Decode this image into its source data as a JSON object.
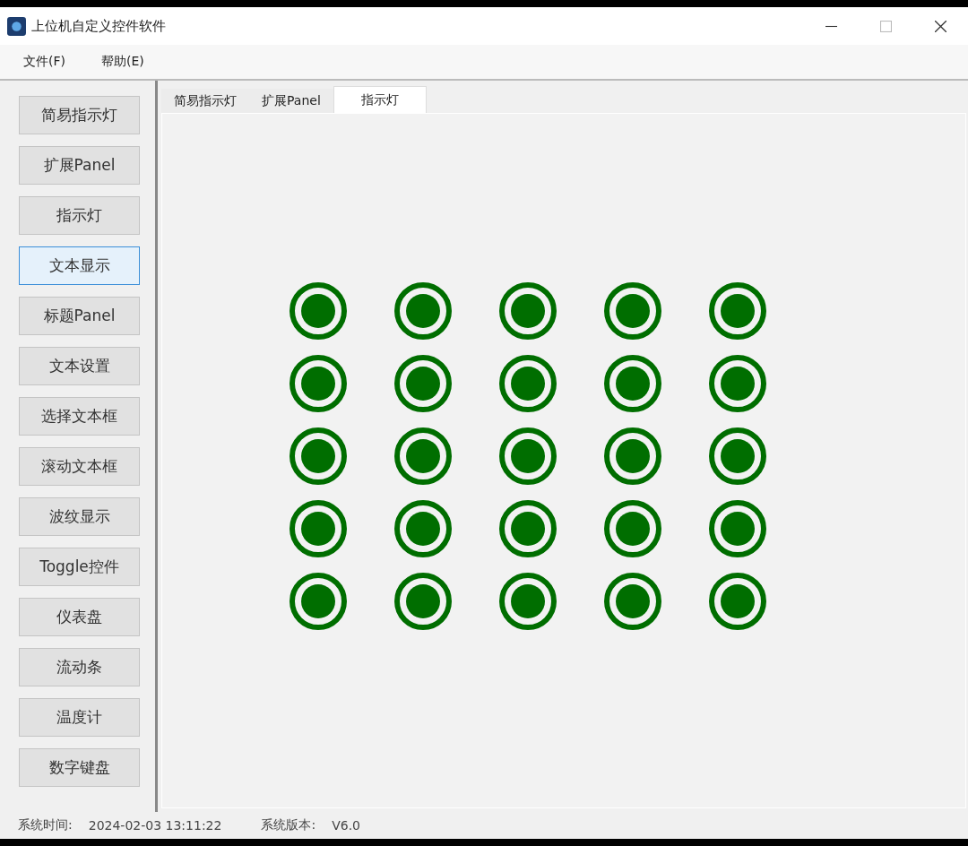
{
  "window": {
    "title": "上位机自定义控件软件"
  },
  "menu": [
    "文件(F)",
    "帮助(E)"
  ],
  "sidebar": {
    "buttons": [
      {
        "label": "简易指示灯",
        "hovered": false
      },
      {
        "label": "扩展Panel",
        "hovered": false
      },
      {
        "label": "指示灯",
        "hovered": false
      },
      {
        "label": "文本显示",
        "hovered": true
      },
      {
        "label": "标题Panel",
        "hovered": false
      },
      {
        "label": "文本设置",
        "hovered": false
      },
      {
        "label": "选择文本框",
        "hovered": false
      },
      {
        "label": "滚动文本框",
        "hovered": false
      },
      {
        "label": "波纹显示",
        "hovered": false
      },
      {
        "label": "Toggle控件",
        "hovered": false
      },
      {
        "label": "仪表盘",
        "hovered": false
      },
      {
        "label": "流动条",
        "hovered": false
      },
      {
        "label": "温度计",
        "hovered": false
      },
      {
        "label": "数字键盘",
        "hovered": false
      }
    ]
  },
  "tabs": [
    {
      "label": "简易指示灯",
      "selected": false
    },
    {
      "label": "扩展Panel",
      "selected": false
    },
    {
      "label": "指示灯",
      "selected": true
    }
  ],
  "lights": [
    [
      {
        "on": true
      },
      {
        "on": true
      },
      {
        "on": true
      },
      {
        "on": true
      },
      {
        "on": true
      }
    ],
    [
      {
        "on": true
      },
      {
        "on": true
      },
      {
        "on": true
      },
      {
        "on": true
      },
      {
        "on": true
      }
    ],
    [
      {
        "on": true
      },
      {
        "on": true
      },
      {
        "on": true
      },
      {
        "on": true
      },
      {
        "on": true
      }
    ],
    [
      {
        "on": true
      },
      {
        "on": true
      },
      {
        "on": true
      },
      {
        "on": true
      },
      {
        "on": true
      }
    ],
    [
      {
        "on": true
      },
      {
        "on": true
      },
      {
        "on": true
      },
      {
        "on": true
      },
      {
        "on": true
      }
    ]
  ],
  "status_bar": {
    "time_label": "系统时间:",
    "time": "2024-02-03 13:11:22",
    "version_label": "系统版本:",
    "version": "V6.0"
  }
}
